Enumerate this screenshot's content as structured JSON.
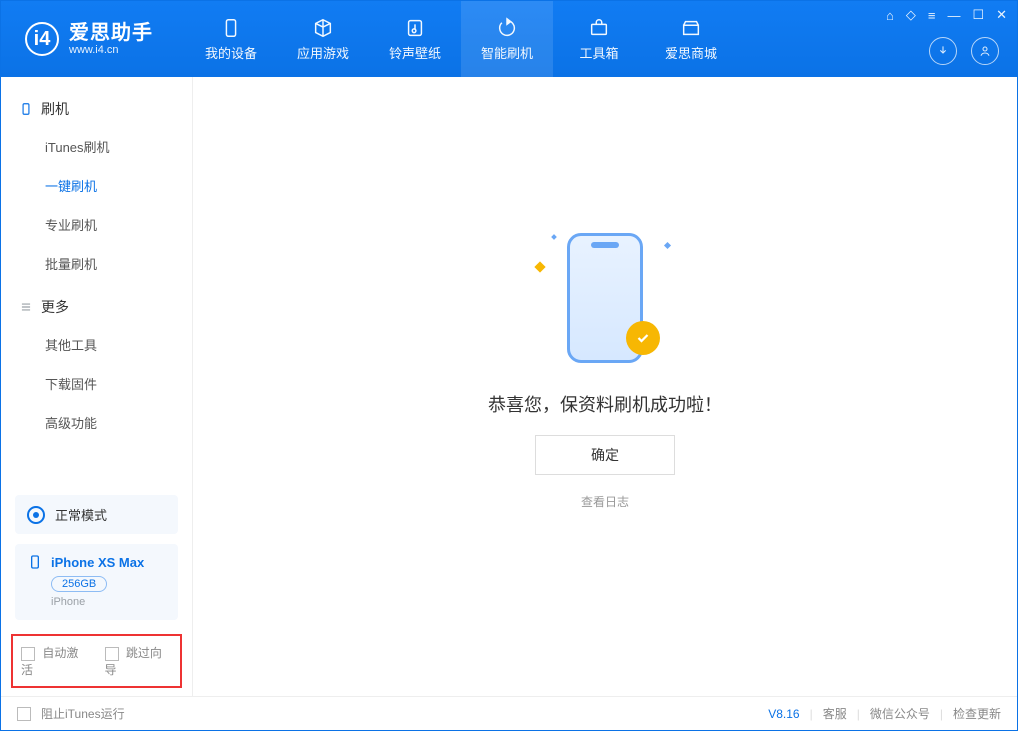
{
  "app": {
    "logo_title": "爱思助手",
    "logo_sub": "www.i4.cn"
  },
  "nav": {
    "items": [
      {
        "label": "我的设备",
        "icon": "device-icon"
      },
      {
        "label": "应用游戏",
        "icon": "cube-icon"
      },
      {
        "label": "铃声壁纸",
        "icon": "music-icon"
      },
      {
        "label": "智能刷机",
        "icon": "refresh-icon",
        "active": true
      },
      {
        "label": "工具箱",
        "icon": "toolbox-icon"
      },
      {
        "label": "爱思商城",
        "icon": "store-icon"
      }
    ]
  },
  "sidebar": {
    "group1_title": "刷机",
    "group1_items": [
      {
        "label": "iTunes刷机"
      },
      {
        "label": "一键刷机",
        "active": true
      },
      {
        "label": "专业刷机"
      },
      {
        "label": "批量刷机"
      }
    ],
    "group2_title": "更多",
    "group2_items": [
      {
        "label": "其他工具"
      },
      {
        "label": "下载固件"
      },
      {
        "label": "高级功能"
      }
    ],
    "mode_label": "正常模式",
    "device_name": "iPhone XS Max",
    "device_capacity": "256GB",
    "device_type": "iPhone",
    "auto_activate_label": "自动激活",
    "skip_guide_label": "跳过向导"
  },
  "main": {
    "success_title": "恭喜您，保资料刷机成功啦！",
    "ok_button": "确定",
    "view_log": "查看日志"
  },
  "footer": {
    "block_itunes": "阻止iTunes运行",
    "version": "V8.16",
    "link_service": "客服",
    "link_wechat": "微信公众号",
    "link_update": "检查更新"
  }
}
